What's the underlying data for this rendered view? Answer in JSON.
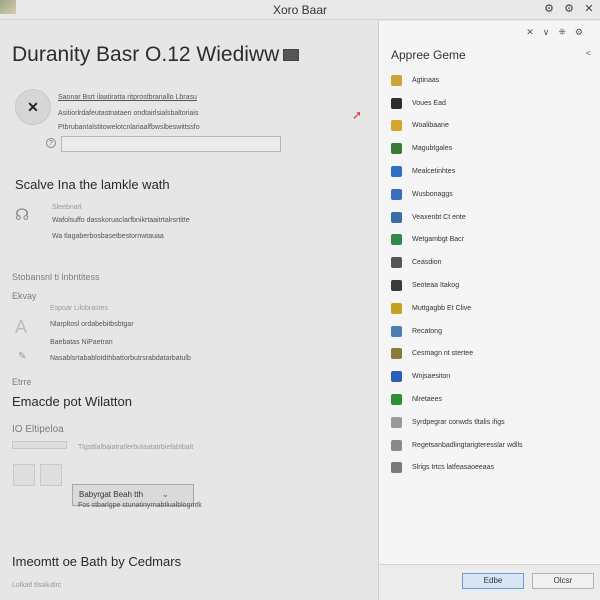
{
  "window": {
    "title": "Xoro Baar",
    "controls": [
      "⚙",
      "⚙",
      "✕"
    ]
  },
  "main": {
    "heading": "Duranity Basr O.12 Wiediww",
    "top_line": "Saonar Bsrt ilaatiratta ritprostbranallo Lbrasu",
    "line_2": "Asitiorlrdafeutastnataen ondtairlsialsbaltoriais",
    "line_3": "Ptbrubantalstitowelotcnlariaalfbwslbeswittssfo",
    "input_value": "",
    "section1": {
      "title": "Scalve Ina the lamkle wath",
      "label": "Sleebnarl",
      "line_1": "Wafolsuffo dasskoruaclarfbnikrtaaitrtalrsrtitte",
      "line_2": "Wa tlagaberbosbasetbestornwtauaa"
    },
    "section2": {
      "title": "Stobansnl ti lnbntitess",
      "sub": "Ekvay",
      "label": "Espoar Lilobrastes",
      "line_1": "Nlarpltosl ordabebitbsbtgar",
      "line_2": "Baebatas NiPaetran",
      "line_3": "Nasablsrtabablotdthbattorbutrsrabdatarbatulb",
      "dim_label": "Etrre"
    },
    "section3": {
      "title": "Emacde pot Wilatton",
      "label": "IO Eltipeloa",
      "desc": "Tlgsttlalbaiatratlerbutaatatrbiefabtbalt",
      "button_label": "Babyrgat Beah tth",
      "caption": "Fos stbarlgpe stunatinyrnabtlualblogmtk"
    },
    "footer_title": "Imeomtt oe Bath by Cedmars",
    "footer_sub": "Lolkatl tlsaliutlrc"
  },
  "panel": {
    "title": "Appree Geme",
    "icons": [
      "✕",
      "∨",
      "⁜",
      "⚙"
    ],
    "items": [
      {
        "label": "Agtinaas",
        "color": "#c9a437"
      },
      {
        "label": "Voues Ead",
        "color": "#2d2d2d"
      },
      {
        "label": "Woalibaane",
        "color": "#d4a42c"
      },
      {
        "label": "Magubtgales",
        "color": "#3a7a3a"
      },
      {
        "label": "Mealcetinhtes",
        "color": "#2f6fc4"
      },
      {
        "label": "Wusbonaggs",
        "color": "#3a6fbf"
      },
      {
        "label": "Veaxenbt Ct ente",
        "color": "#3b6ea8"
      },
      {
        "label": "Wetgambgt Bacr",
        "color": "#2f8a4a"
      },
      {
        "label": "Ceasdion",
        "color": "#555555"
      },
      {
        "label": "Seoteaa Itakog",
        "color": "#3a3a3a"
      },
      {
        "label": "Muttgagbb Et Clive",
        "color": "#c6a01f"
      },
      {
        "label": "Recatong",
        "color": "#4a7fb0"
      },
      {
        "label": "Cesmagn nt stertee",
        "color": "#8a7a3a"
      },
      {
        "label": "Wnjsaesiton",
        "color": "#2a5fb8"
      },
      {
        "label": "Nlretaees",
        "color": "#2e8f3a"
      },
      {
        "label": "Syrdpegrar conwds tltalis ifigs",
        "color": "#9a9a9a"
      },
      {
        "label": "Regetsanbadlingtarigteresslar wdlls",
        "color": "#8a8a8a"
      },
      {
        "label": "Slrigs trtcs latfeasaoeeaas",
        "color": "#7a7a7a"
      }
    ],
    "ok_label": "Edbe",
    "cancel_label": "Olcsr"
  },
  "colors": {
    "accent": "#d7e6f7",
    "background": "#e6e6e6",
    "panel": "#f5f5f5"
  }
}
